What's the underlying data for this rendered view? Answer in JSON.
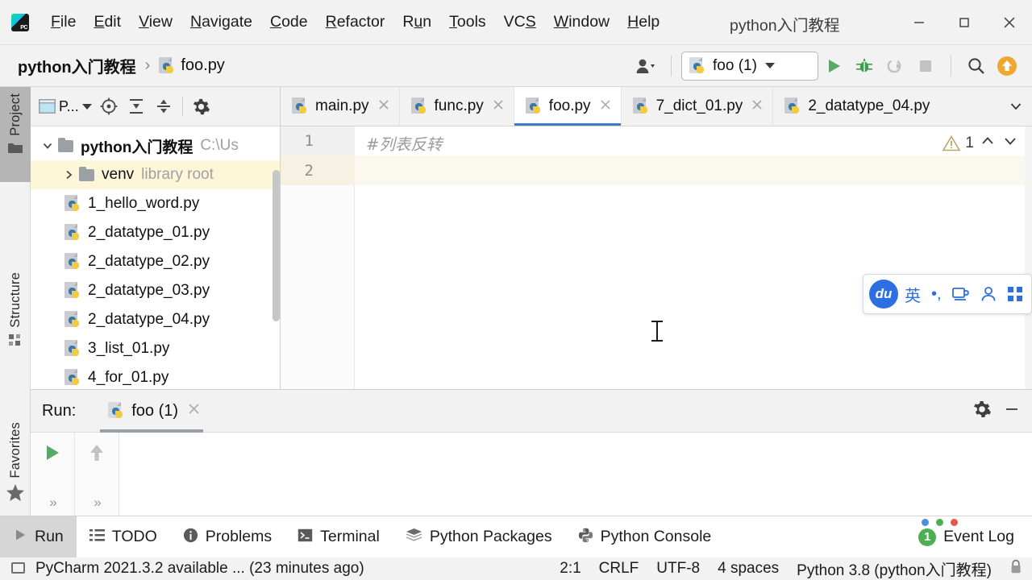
{
  "window": {
    "title": "python入门教程",
    "logo_icon": "pycharm-logo-icon",
    "minimize_icon": "minimize-icon",
    "maximize_icon": "maximize-icon",
    "close_icon": "close-icon"
  },
  "menu": [
    {
      "label": "File",
      "mnemonic": "F"
    },
    {
      "label": "Edit",
      "mnemonic": "E"
    },
    {
      "label": "View",
      "mnemonic": "V"
    },
    {
      "label": "Navigate",
      "mnemonic": "N"
    },
    {
      "label": "Code",
      "mnemonic": "C"
    },
    {
      "label": "Refactor",
      "mnemonic": "R"
    },
    {
      "label": "Run",
      "mnemonic": "u"
    },
    {
      "label": "Tools",
      "mnemonic": "T"
    },
    {
      "label": "VCS",
      "mnemonic": "S"
    },
    {
      "label": "Window",
      "mnemonic": "W"
    },
    {
      "label": "Help",
      "mnemonic": "H"
    }
  ],
  "navbar": {
    "project_crumb": "python入门教程",
    "separator": "›",
    "file_crumb": "foo.py",
    "run_config": "foo (1)",
    "icons": {
      "user": "user-avatar-icon",
      "run": "run-icon",
      "debug": "debug-icon",
      "coverage": "run-with-coverage-icon",
      "stop": "stop-icon",
      "search": "search-everywhere-icon",
      "update": "update-available-icon"
    }
  },
  "rail": {
    "project": "Project",
    "structure": "Structure",
    "favorites": "Favorites"
  },
  "project_panel": {
    "title": "P...",
    "icons": {
      "select_in": "select-opened-file-icon",
      "expand": "expand-all-icon",
      "collapse": "collapse-all-icon",
      "settings": "gear-icon"
    },
    "tree": [
      {
        "name": "python入门教程",
        "meta": "C:\\Us",
        "type": "folder",
        "expanded": true,
        "bold": true,
        "indent": 0,
        "selected": false
      },
      {
        "name": "venv",
        "meta": "library root",
        "type": "folder",
        "expanded": false,
        "bold": false,
        "indent": 1,
        "selected": true
      },
      {
        "name": "1_hello_word.py",
        "meta": "",
        "type": "python",
        "indent": 2,
        "selected": false
      },
      {
        "name": "2_datatype_01.py",
        "meta": "",
        "type": "python",
        "indent": 2,
        "selected": false
      },
      {
        "name": "2_datatype_02.py",
        "meta": "",
        "type": "python",
        "indent": 2,
        "selected": false
      },
      {
        "name": "2_datatype_03.py",
        "meta": "",
        "type": "python",
        "indent": 2,
        "selected": false
      },
      {
        "name": "2_datatype_04.py",
        "meta": "",
        "type": "python",
        "indent": 2,
        "selected": false
      },
      {
        "name": "3_list_01.py",
        "meta": "",
        "type": "python",
        "indent": 2,
        "selected": false
      },
      {
        "name": "4_for_01.py",
        "meta": "",
        "type": "python",
        "indent": 2,
        "selected": false
      }
    ]
  },
  "editor": {
    "tabs": [
      {
        "label": "main.py",
        "active": false
      },
      {
        "label": "func.py",
        "active": false
      },
      {
        "label": "foo.py",
        "active": true
      },
      {
        "label": "7_dict_01.py",
        "active": false
      },
      {
        "label": "2_datatype_04.py",
        "active": false
      }
    ],
    "overflow_icon": "chevron-down-icon",
    "lines": [
      {
        "number": "1",
        "text": "#列表反转"
      },
      {
        "number": "2",
        "text": ""
      }
    ],
    "inspection": {
      "count": "1",
      "icon": "warning-triangle-icon",
      "prev": "chevron-up-icon",
      "next": "chevron-down-icon"
    }
  },
  "ime": {
    "logo": "du",
    "mode": "英",
    "punct": "•,",
    "keyboard_icon": "keyboard-icon",
    "user_icon": "person-icon",
    "apps_icon": "app-grid-icon"
  },
  "run_window": {
    "label": "Run:",
    "tab": "foo (1)",
    "settings_icon": "gear-icon",
    "minimize_icon": "minimize-icon",
    "rerun_icon": "rerun-icon",
    "up_icon": "arrow-up-icon",
    "expand_icon": "»",
    "output": ""
  },
  "bottom_toolbar": [
    {
      "label": "Run",
      "icon": "run-icon",
      "active": true
    },
    {
      "label": "TODO",
      "icon": "todo-list-icon",
      "active": false
    },
    {
      "label": "Problems",
      "icon": "problems-icon",
      "active": false
    },
    {
      "label": "Terminal",
      "icon": "terminal-icon",
      "active": false
    },
    {
      "label": "Python Packages",
      "icon": "packages-icon",
      "active": false
    },
    {
      "label": "Python Console",
      "icon": "python-console-icon",
      "active": false
    }
  ],
  "event_log": {
    "label": "Event Log",
    "count": "1",
    "dots": [
      "#4a90e2",
      "#4caf50",
      "#e8554e"
    ]
  },
  "statusbar": {
    "message": "PyCharm 2021.3.2 available ... (23 minutes ago)",
    "caret": "2:1",
    "line_sep": "CRLF",
    "encoding": "UTF-8",
    "indent": "4 spaces",
    "interpreter": "Python 3.8 (python入门教程)",
    "lock_icon": "lock-icon",
    "monitor_icon": "monitor-icon"
  },
  "colors": {
    "accent_blue": "#3d7cc9",
    "run_green": "#59a869",
    "selection_yellow": "#fdf6d8",
    "caret_line": "#fbf8ef",
    "ime_blue": "#2d6fe0"
  }
}
